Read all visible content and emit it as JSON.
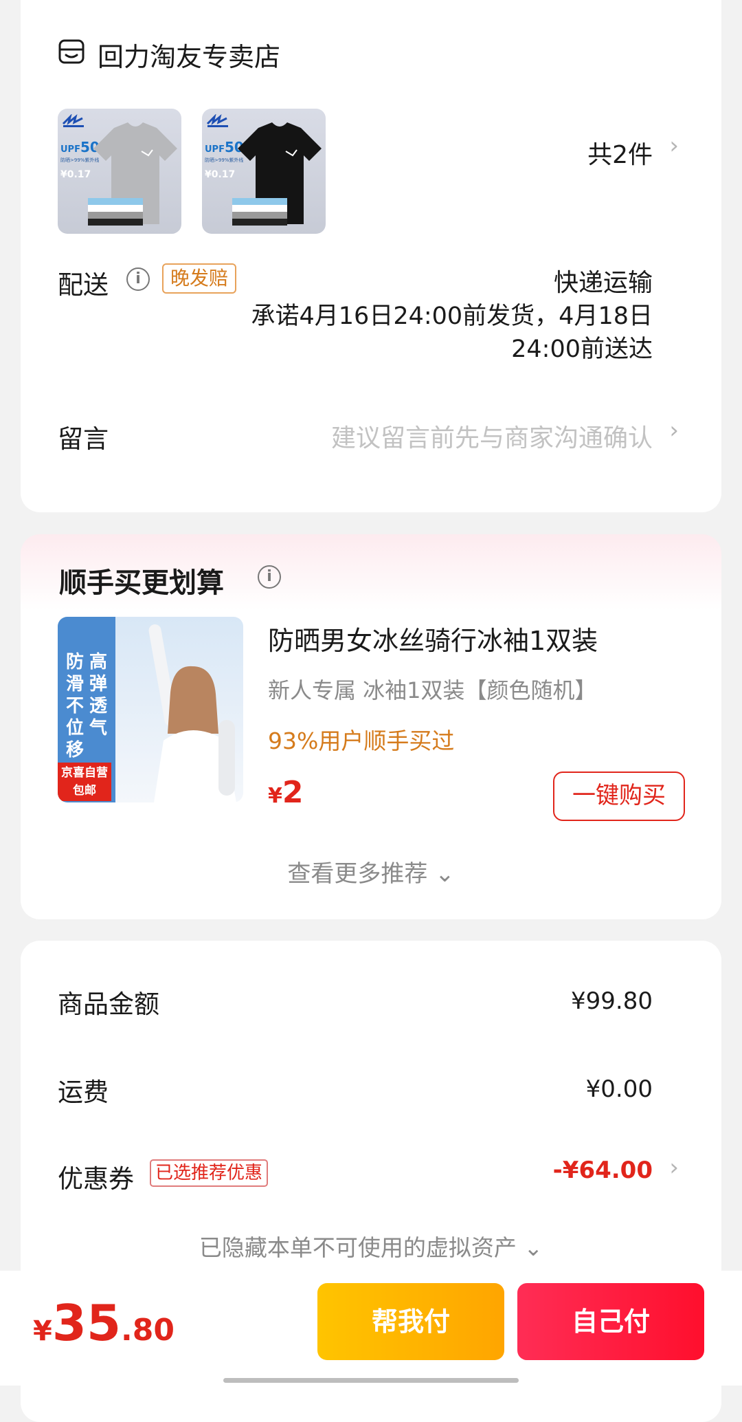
{
  "store": {
    "icon": "store-icon",
    "name": "回力淘友专卖店",
    "thumbnails": [
      {
        "upf": "UPF",
        "upf_value": "50+",
        "upf_sub": "防晒>99%紫外线",
        "price": "¥0.17",
        "shirt_color": "#b7b8bb"
      },
      {
        "upf": "UPF",
        "upf_value": "50+",
        "upf_sub": "防晒>99%紫外线",
        "price": "¥0.17",
        "shirt_color": "#141414"
      }
    ],
    "item_count": "共2件",
    "delivery": {
      "label": "配送",
      "badge": "晚发赔",
      "method": "快递运输",
      "promise": "承诺4月16日24:00前发货，4月18日24:00前送达"
    },
    "note": {
      "label": "留言",
      "placeholder": "建议留言前先与商家沟通确认"
    }
  },
  "bundle": {
    "title": "顺手买更划算",
    "image_text_1": "高弹透气",
    "image_text_2": "防滑不位移",
    "image_tag_1": "京喜自营",
    "image_tag_2": "包邮",
    "product_name": "防晒男女冰丝骑行冰袖1双装",
    "product_sub": "新人专属 冰袖1双装【颜色随机】",
    "stat": "93%用户顺手买过",
    "currency": "¥",
    "price": "2",
    "buy_label": "一键购买",
    "more_label": "查看更多推荐 ⌄"
  },
  "summary": {
    "goods_label": "商品金额",
    "goods_value": "¥99.80",
    "shipping_label": "运费",
    "shipping_value": "¥0.00",
    "coupon_label": "优惠券",
    "coupon_badge": "已选推荐优惠",
    "coupon_value": "-¥64.00",
    "hidden_assets": "已隐藏本单不可使用的虚拟资产 ⌄"
  },
  "bottom": {
    "currency": "¥",
    "total_int": "35",
    "total_dec": ".80",
    "help_pay": "帮我付",
    "self_pay": "自己付"
  },
  "colors": {
    "accent_red": "#e1251b",
    "accent_orange": "#d57b1c",
    "help_pay_yellow": "#ffb400",
    "self_pay_red": "#ff1a3c"
  }
}
